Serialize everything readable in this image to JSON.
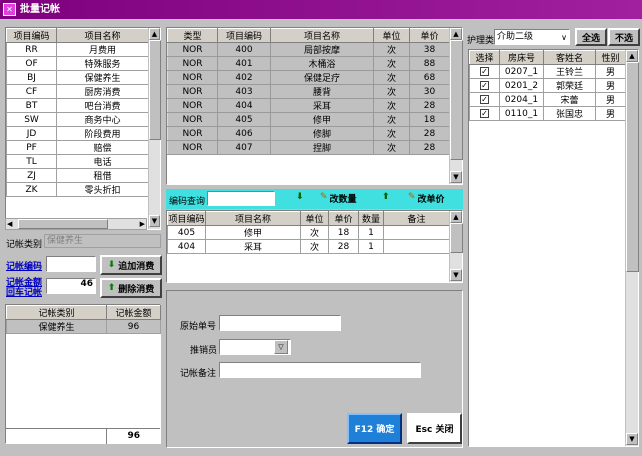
{
  "window": {
    "title": "批量记帐",
    "icon": "app-icon"
  },
  "left_table": {
    "headers": [
      "项目编码",
      "项目名称"
    ],
    "rows": [
      [
        "RR",
        "月费用"
      ],
      [
        "OF",
        "特殊服务"
      ],
      [
        "BJ",
        "保健养生"
      ],
      [
        "CF",
        "厨房消费"
      ],
      [
        "BT",
        "吧台消费"
      ],
      [
        "SW",
        "商务中心"
      ],
      [
        "JD",
        "阶段费用"
      ],
      [
        "PF",
        "赔偿"
      ],
      [
        "TL",
        "电话"
      ],
      [
        "ZJ",
        "租借"
      ],
      [
        "ZK",
        "零头折扣"
      ]
    ]
  },
  "account_type": {
    "label": "记帐类别",
    "value": "保健养生"
  },
  "account_code": {
    "label": "记帐编码",
    "value": ""
  },
  "account_amount": {
    "label": "记帐金额",
    "label2": "回车记帐",
    "value": "46"
  },
  "buttons": {
    "add": "追加消费",
    "delete": "删除消费",
    "confirm": "F12 确定",
    "close": "Esc 关闭",
    "select_all": "全选",
    "select_none": "不选",
    "modify_qty": "改数量",
    "modify_price": "改单价"
  },
  "summary_table": {
    "headers": [
      "记帐类别",
      "记帐金额"
    ],
    "rows": [
      [
        "保健养生",
        "96"
      ]
    ],
    "total": "96"
  },
  "items_table": {
    "headers": [
      "类型",
      "项目编码",
      "项目名称",
      "单位",
      "单价"
    ],
    "rows": [
      [
        "NOR",
        "400",
        "局部按摩",
        "次",
        "38"
      ],
      [
        "NOR",
        "401",
        "木桶浴",
        "次",
        "88"
      ],
      [
        "NOR",
        "402",
        "保健足疗",
        "次",
        "68"
      ],
      [
        "NOR",
        "403",
        "腰背",
        "次",
        "30"
      ],
      [
        "NOR",
        "404",
        "采耳",
        "次",
        "28"
      ],
      [
        "NOR",
        "405",
        "修甲",
        "次",
        "18"
      ],
      [
        "NOR",
        "406",
        "修脚",
        "次",
        "28"
      ],
      [
        "NOR",
        "407",
        "捏脚",
        "次",
        "28"
      ]
    ]
  },
  "code_query": {
    "label": "编码查询",
    "value": ""
  },
  "consume_table": {
    "headers": [
      "项目编码",
      "项目名称",
      "单位",
      "单价",
      "数量",
      "备注"
    ],
    "rows": [
      [
        "405",
        "修甲",
        "次",
        "18",
        "1",
        ""
      ],
      [
        "404",
        "采耳",
        "次",
        "28",
        "1",
        ""
      ]
    ]
  },
  "form": {
    "original_no_label": "原始单号",
    "original_no": "",
    "seller_label": "推销员",
    "seller": "",
    "remark_label": "记帐备注",
    "remark": ""
  },
  "nurse": {
    "label": "护理类",
    "value": "介助二级"
  },
  "rooms_table": {
    "headers": [
      "选择",
      "房床号",
      "客姓名",
      "性别"
    ],
    "rows": [
      [
        "0207_1",
        "王铃兰",
        "男"
      ],
      [
        "0201_2",
        "郭荣廷",
        "男"
      ],
      [
        "0204_1",
        "宋蕾",
        "男"
      ],
      [
        "0110_1",
        "张国忠",
        "男"
      ]
    ]
  }
}
